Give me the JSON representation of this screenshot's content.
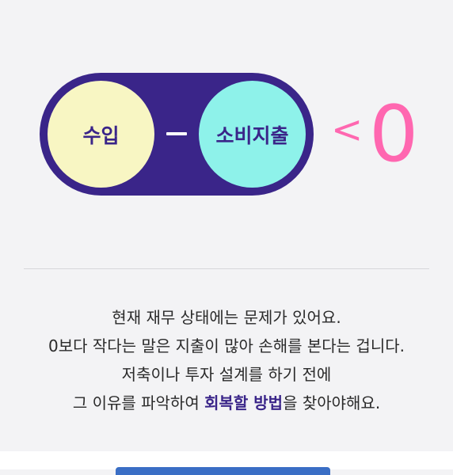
{
  "formula": {
    "income_label": "수입",
    "minus_sign": "−",
    "expense_label": "소비지출",
    "less_than": "<",
    "zero": "0"
  },
  "message": {
    "line1": "현재 재무 상태에는 문제가 있어요.",
    "line2": "0보다 작다는 말은 지출이 많아 손해를 본다는 겁니다.",
    "line3": "저축이나 투자 설계를 하기 전에",
    "line4_prefix": "그 이유를 파악하여 ",
    "line4_highlight": "회복할 방법",
    "line4_suffix": "을 찾아야해요."
  },
  "colors": {
    "pill": "#3a2589",
    "income_circle": "#f8f6c3",
    "expense_circle": "#8ef2ea",
    "accent_pink": "#ff67b0",
    "highlight_text": "#3a2589"
  }
}
